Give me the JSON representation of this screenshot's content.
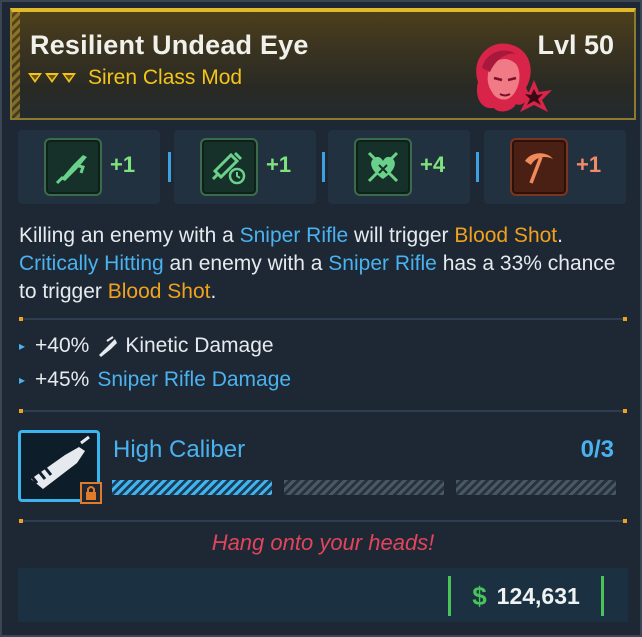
{
  "item": {
    "name": "Resilient Undead Eye",
    "type": "Siren Class Mod",
    "level": "Lvl 50",
    "rarity_color": "#f3c41a",
    "portrait_icon": "siren-portrait-icon"
  },
  "skills": [
    {
      "icon": "sniper-skill-icon",
      "value": "+1",
      "tone": "green"
    },
    {
      "icon": "syringe-timer-skill-icon",
      "value": "+1",
      "tone": "green"
    },
    {
      "icon": "heart-crossed-skill-icon",
      "value": "+4",
      "tone": "green"
    },
    {
      "icon": "scythe-skill-icon",
      "value": "+1",
      "tone": "red"
    }
  ],
  "description": {
    "p1": "Killing an enemy with a ",
    "k1": "Sniper Rifle",
    "p2": " will trigger ",
    "k2": "Blood Shot",
    "p3": ". ",
    "k3": "Critically Hitting",
    "p4": " an enemy with a ",
    "k4": "Sniper Rifle",
    "p5": " has a 33% chance to trigger ",
    "k5": "Blood Shot",
    "p6": "."
  },
  "stats": [
    {
      "value": "+40%",
      "label": "Kinetic Damage",
      "icon": "kinetic-icon"
    },
    {
      "value": "+45%",
      "label": "Sniper Rifle Damage"
    }
  ],
  "augment": {
    "name": "High Caliber",
    "progress": "0/3",
    "progress_fraction": 0.33,
    "icon": "bullet-icon"
  },
  "flavor_text": "Hang onto your heads!",
  "price": {
    "symbol": "$",
    "value": "124,631"
  },
  "colors": {
    "accent_blue": "#4ab2f0",
    "accent_orange": "#f0a11e",
    "flavor_red": "#e2445c",
    "money_green": "#48c45a"
  }
}
